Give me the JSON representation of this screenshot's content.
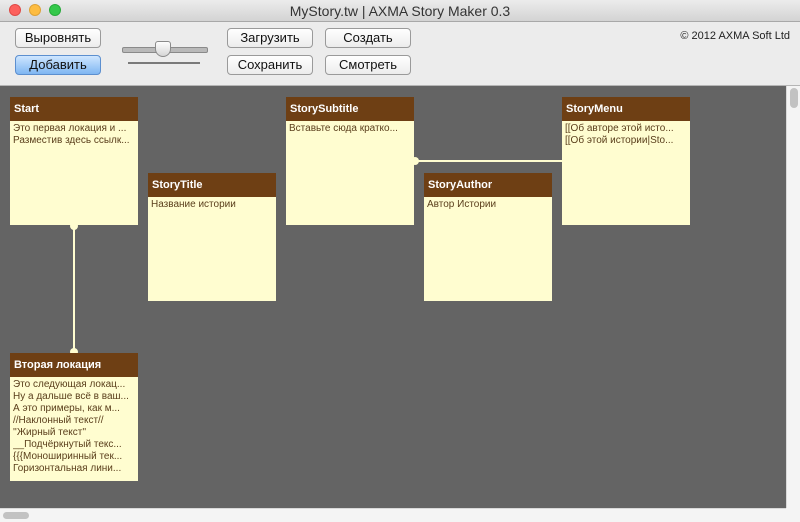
{
  "window": {
    "title": "MyStory.tw | AXMA Story Maker 0.3"
  },
  "toolbar": {
    "align_label": "Выровнять",
    "add_label": "Добавить",
    "load_label": "Загрузить",
    "save_label": "Сохранить",
    "create_label": "Создать",
    "view_label": "Смотреть",
    "copyright": "© 2012 AXMA Soft Ltd"
  },
  "colors": {
    "canvas": "#646464",
    "card_header": "#6e3f14",
    "card_body": "#fffdd0",
    "connector": "#fffdd0"
  },
  "cards": [
    {
      "title": "Start",
      "lines": [
        "Это первая локация и ...",
        "Разместив здесь ссылк..."
      ]
    },
    {
      "title": "StoryTitle",
      "lines": [
        "Название истории"
      ]
    },
    {
      "title": "StorySubtitle",
      "lines": [
        "Вставьте сюда кратко..."
      ]
    },
    {
      "title": "StoryAuthor",
      "lines": [
        "Автор Истории"
      ]
    },
    {
      "title": "StoryMenu",
      "lines": [
        "[[Об авторе этой исто...",
        "[[Об этой истории|Sto..."
      ]
    },
    {
      "title": "Вторая локация",
      "lines": [
        "Это следующая локац...",
        "Ну а дальше всё в ваш...",
        "А это примеры, как м...",
        "//Наклонный текст//",
        "''Жирный текст''",
        "__Подчёркнутый текс...",
        "{{{Моноширинный тек...",
        "Горизонтальная лини..."
      ]
    }
  ]
}
